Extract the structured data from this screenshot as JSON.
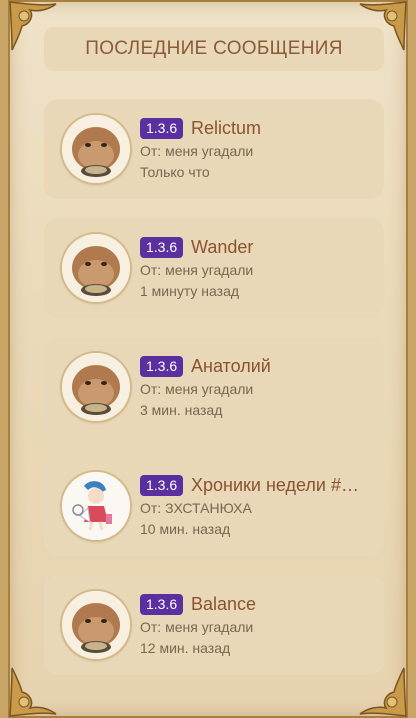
{
  "header": {
    "title": "ПОСЛЕДНИЕ СООБЩЕНИЯ"
  },
  "messages": [
    {
      "version": "1.3.6",
      "title": "Relictum",
      "author": "От: меня угадали",
      "time": "Только что",
      "avatar": "hamster"
    },
    {
      "version": "1.3.6",
      "title": "Wander",
      "author": "От: меня угадали",
      "time": "1 минуту назад",
      "avatar": "hamster"
    },
    {
      "version": "1.3.6",
      "title": "Анатолий",
      "author": "От: меня угадали",
      "time": "3 мин. назад",
      "avatar": "hamster"
    },
    {
      "version": "1.3.6",
      "title": "Хроники недели #…",
      "author": "От: ЗХСТАНЮХА",
      "time": "10 мин. назад",
      "avatar": "anime-girl"
    },
    {
      "version": "1.3.6",
      "title": "Balance",
      "author": "От: меня угадали",
      "time": "12 мин. назад",
      "avatar": "hamster"
    }
  ],
  "colors": {
    "version_badge": "#5b2fa0",
    "title_text": "#8a5230",
    "card_bg": "#e8d8b8",
    "frame_gold": "#c9a567"
  }
}
